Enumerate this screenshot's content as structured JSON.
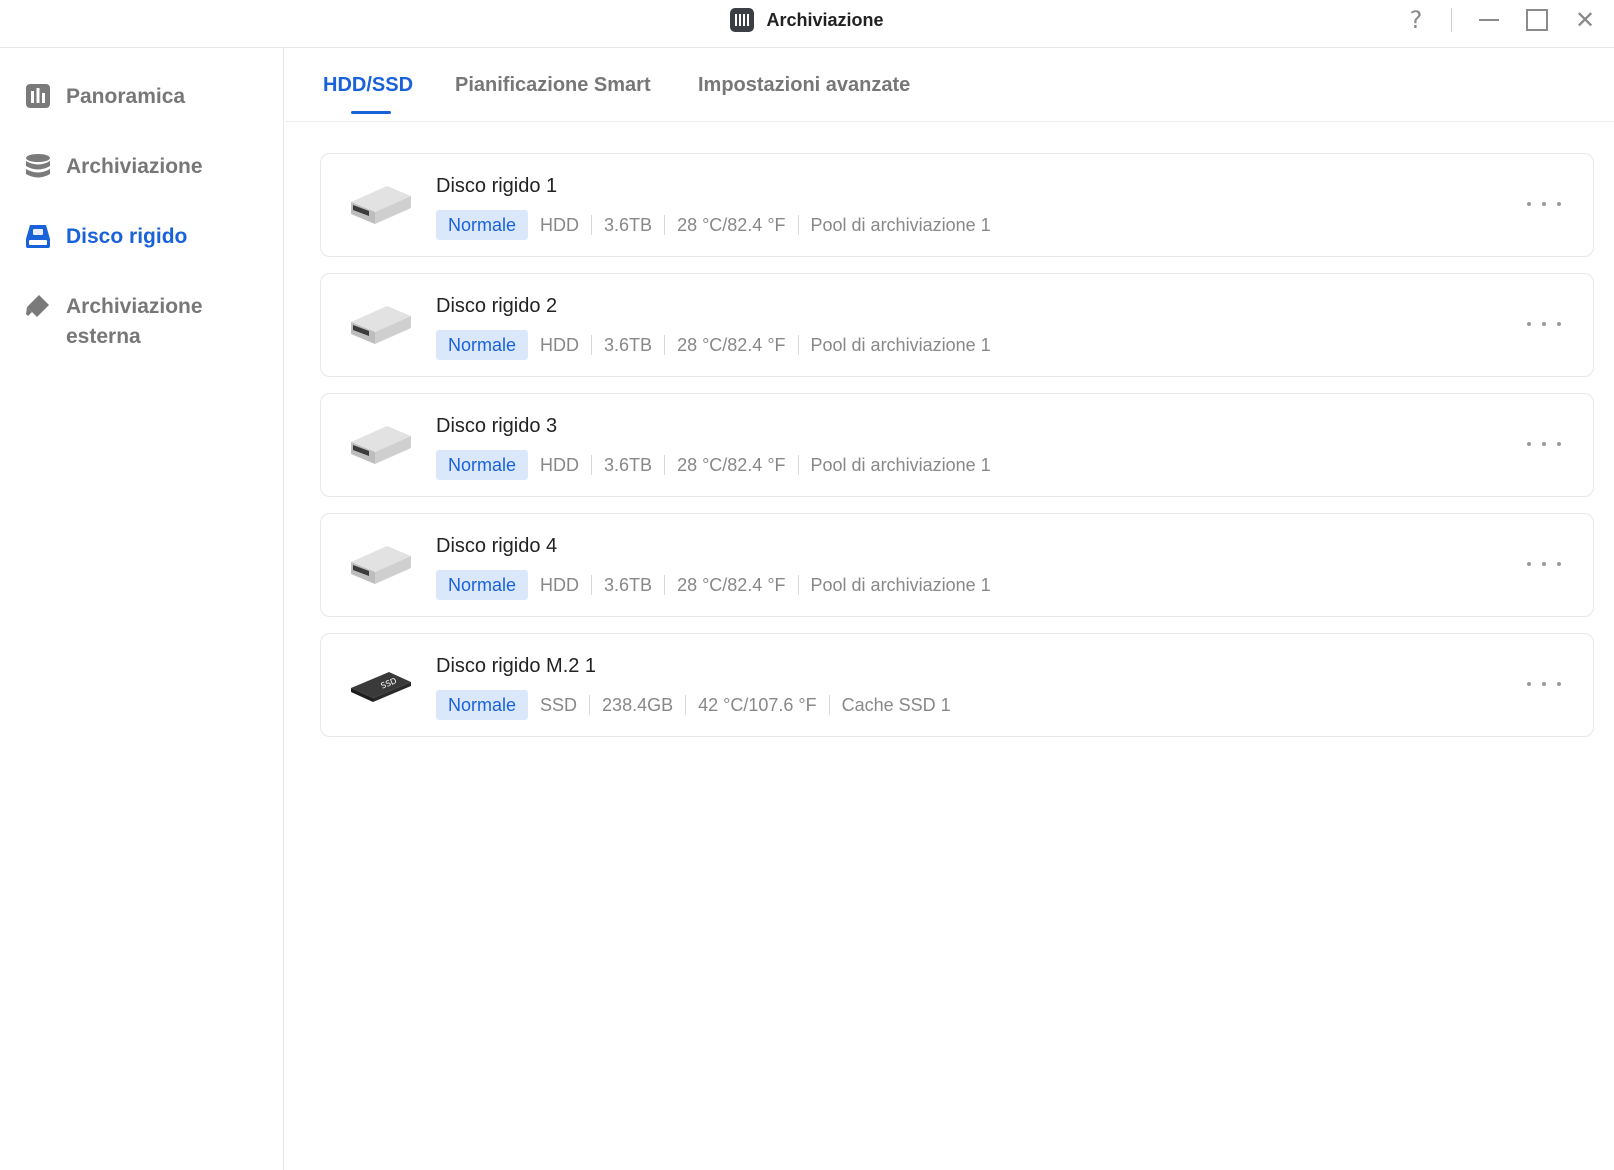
{
  "window": {
    "title": "Archiviazione",
    "help_glyph": "?",
    "close_glyph": "✕"
  },
  "sidebar": {
    "items": [
      {
        "label": "Panoramica",
        "icon": "bar-chart-icon",
        "active": false
      },
      {
        "label": "Archiviazione",
        "icon": "database-icon",
        "active": false
      },
      {
        "label": "Disco rigido",
        "icon": "hard-drive-icon",
        "active": true
      },
      {
        "label": "Archiviazione",
        "label2": "esterna",
        "icon": "usb-drive-icon",
        "active": false
      }
    ]
  },
  "tabs": [
    {
      "label": "HDD/SSD",
      "active": true
    },
    {
      "label": "Pianificazione Smart",
      "active": false
    },
    {
      "label": "Impostazioni avanzate",
      "active": false
    }
  ],
  "disks": [
    {
      "name": "Disco rigido 1",
      "status": "Normale",
      "type": "HDD",
      "size": "3.6TB",
      "temp": "28 °C/82.4 °F",
      "pool": "Pool di archiviazione 1",
      "icon": "hdd-icon"
    },
    {
      "name": "Disco rigido 2",
      "status": "Normale",
      "type": "HDD",
      "size": "3.6TB",
      "temp": "28 °C/82.4 °F",
      "pool": "Pool di archiviazione 1",
      "icon": "hdd-icon"
    },
    {
      "name": "Disco rigido 3",
      "status": "Normale",
      "type": "HDD",
      "size": "3.6TB",
      "temp": "28 °C/82.4 °F",
      "pool": "Pool di archiviazione 1",
      "icon": "hdd-icon"
    },
    {
      "name": "Disco rigido 4",
      "status": "Normale",
      "type": "HDD",
      "size": "3.6TB",
      "temp": "28 °C/82.4 °F",
      "pool": "Pool di archiviazione 1",
      "icon": "hdd-icon"
    },
    {
      "name": "Disco rigido M.2 1",
      "status": "Normale",
      "type": "SSD",
      "size": "238.4GB",
      "temp": "42 °C/107.6 °F",
      "pool": "Cache SSD 1",
      "icon": "ssd-icon",
      "ssd_label": "SSD"
    }
  ],
  "colors": {
    "accent": "#1a62d8",
    "badge_bg": "#dbe8fb",
    "muted_text": "#888888"
  }
}
